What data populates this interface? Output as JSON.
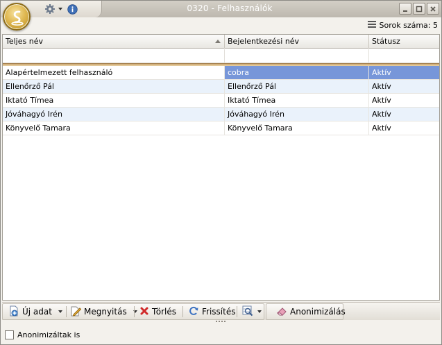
{
  "window": {
    "title": "0320 - Felhasználók"
  },
  "rows_info": {
    "label": "Sorok száma: 5"
  },
  "grid": {
    "columns": [
      "Teljes név",
      "Bejelentkezési név",
      "Státusz"
    ],
    "rows": [
      {
        "full_name": "Alapértelmezett felhasználó",
        "login": "cobra",
        "status": "Aktív"
      },
      {
        "full_name": "Ellenőrző Pál",
        "login": "Ellenőrző Pál",
        "status": "Aktív"
      },
      {
        "full_name": "Iktató Tímea",
        "login": "Iktató Tímea",
        "status": "Aktív"
      },
      {
        "full_name": "Jóváhagyó Irén",
        "login": "Jóváhagyó Irén",
        "status": "Aktív"
      },
      {
        "full_name": "Könyvelő Tamara",
        "login": "Könyvelő Tamara",
        "status": "Aktív"
      }
    ]
  },
  "toolbar": {
    "new_label": "Új adat",
    "open_label": "Megnyitás",
    "delete_label": "Törlés",
    "refresh_label": "Frissítés",
    "anonymize_label": "Anonimizálás"
  },
  "footer": {
    "anonymized_checkbox_label": "Anonimizáltak is"
  },
  "colors": {
    "selection": "#7796d9",
    "alt_row": "#eaf2fb",
    "title_text": "#ffffff"
  }
}
